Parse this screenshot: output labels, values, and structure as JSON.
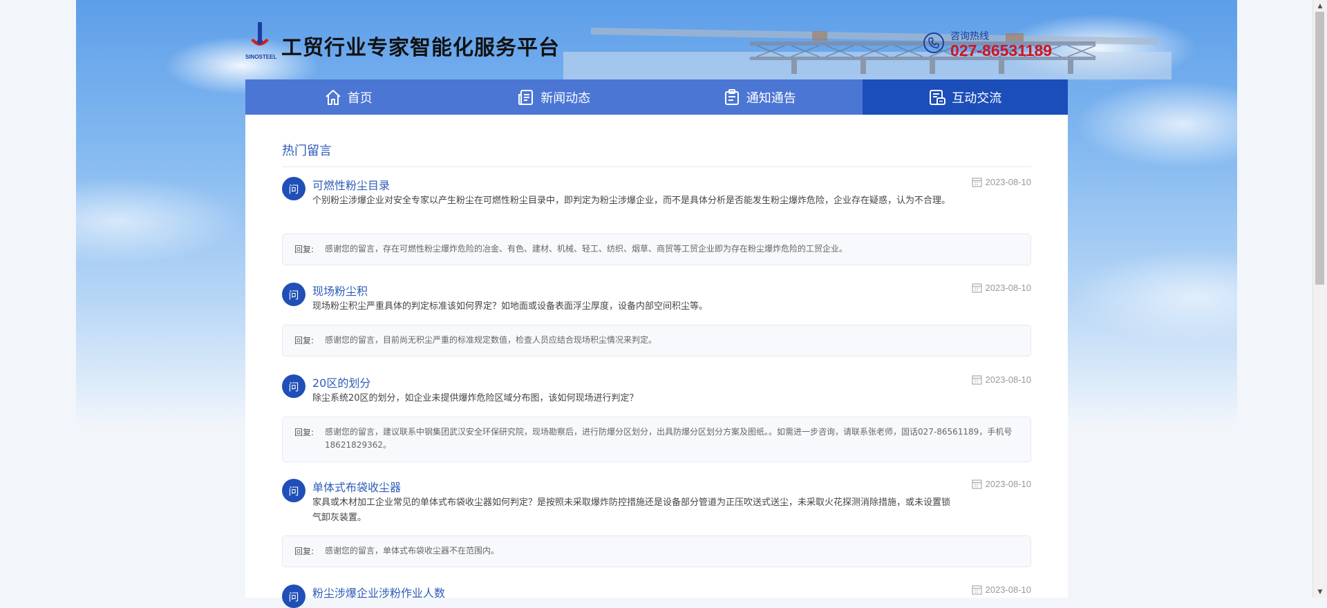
{
  "header": {
    "logo_text": "SINOSTEEL",
    "title": "工贸行业专家智能化服务平台",
    "hotline_label": "咨询热线",
    "hotline_number": "027-86531189"
  },
  "nav": {
    "items": [
      {
        "label": "首页",
        "icon": "home-icon"
      },
      {
        "label": "新闻动态",
        "icon": "news-icon"
      },
      {
        "label": "通知通告",
        "icon": "notice-icon"
      },
      {
        "label": "互动交流",
        "icon": "interaction-icon",
        "active": true
      }
    ]
  },
  "section": {
    "title": "热门留言"
  },
  "questions": [
    {
      "badge": "问",
      "title": "可燃性粉尘目录",
      "date": "2023-08-10",
      "text": "个别粉尘涉爆企业对安全专家以产生粉尘在可燃性粉尘目录中，即判定为粉尘涉爆企业，而不是具体分析是否能发生粉尘爆炸危险，企业存在疑惑，认为不合理。",
      "reply_label": "回复:",
      "reply": "感谢您的留言，存在可燃性粉尘爆炸危险的冶金、有色、建材、机械、轻工、纺织、烟草、商贸等工贸企业即为存在粉尘爆炸危险的工贸企业。"
    },
    {
      "badge": "问",
      "title": "现场粉尘积",
      "date": "2023-08-10",
      "text": "现场粉尘积尘严重具体的判定标准该如何界定？如地面或设备表面浮尘厚度，设备内部空间积尘等。",
      "reply_label": "回复:",
      "reply": "感谢您的留言，目前尚无积尘严重的标准规定数值，检查人员应结合现场积尘情况来判定。"
    },
    {
      "badge": "问",
      "title": "20区的划分",
      "date": "2023-08-10",
      "text": "除尘系统20区的划分，如企业未提供爆炸危险区域分布图，该如何现场进行判定？",
      "reply_label": "回复:",
      "reply": "感谢您的留言，建议联系中钢集团武汉安全环保研究院，现场勘察后，进行防爆分区划分，出具防爆分区划分方案及图纸。。如需进一步咨询，请联系张老师，固话027-86561189，手机号18621829362。"
    },
    {
      "badge": "问",
      "title": "单体式布袋收尘器",
      "date": "2023-08-10",
      "text": "家具或木材加工企业常见的单体式布袋收尘器如何判定？是按照未采取爆炸防控措施还是设备部分管道为正压吹送式送尘，未采取火花探测消除措施，或未设置锁气卸灰装置。",
      "reply_label": "回复:",
      "reply": "感谢您的留言，单体式布袋收尘器不在范围内。"
    },
    {
      "badge": "问",
      "title": "粉尘涉爆企业涉粉作业人数",
      "date": "2023-08-10",
      "text": "",
      "reply_label": "",
      "reply": ""
    }
  ]
}
